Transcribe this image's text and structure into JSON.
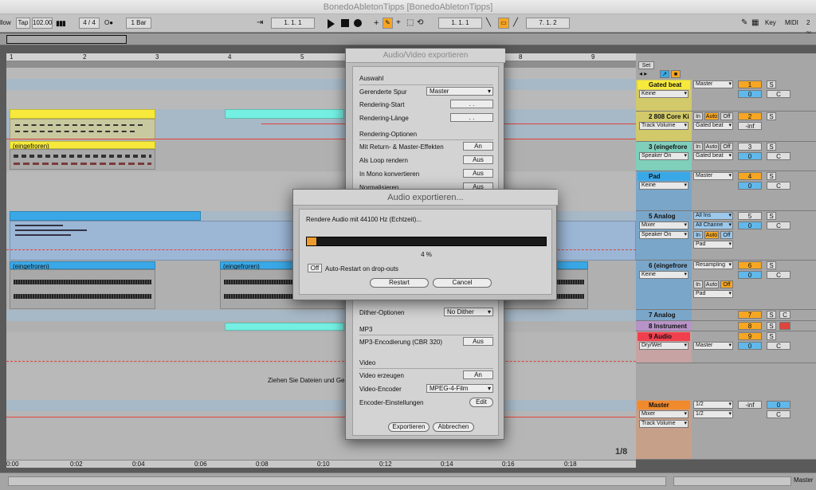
{
  "window_title": "BonedoAbletonTipps  [BonedoAbletonTipps]",
  "transport": {
    "follow": "llow",
    "tap": "Tap",
    "tempo": "102.00",
    "time_sig": "4 / 4",
    "metro": "O●",
    "quantize": "1 Bar",
    "arrangement_pos": "1.  1.  1",
    "loop_start": "1.  1.  1",
    "loop_length": "7.  1.  2",
    "key": "Key",
    "midi": "MIDI",
    "cpu": "2 %"
  },
  "ruler": {
    "bars": [
      "1",
      "2",
      "3",
      "4",
      "5",
      "8",
      "9"
    ],
    "times": [
      "0:00",
      "0:02",
      "0:04",
      "0:06",
      "0:08",
      "0:10",
      "0:12",
      "0:14",
      "0:16",
      "0:18"
    ]
  },
  "arrangement": {
    "frozen_label_1": "(eingefroren)",
    "frozen_label_2": "(eingefroren)",
    "frozen_label_3": "(eingefroren)",
    "drop_hint": "Ziehen Sie Dateien und Gerä",
    "zoom_indicator": "1/8"
  },
  "mixer": {
    "set_label": "Set",
    "tracks": [
      {
        "name": "Gated beat",
        "route_a": "Master",
        "route_b": "Keine",
        "num": "1",
        "num2": "0",
        "s": "S",
        "c": "C",
        "color": "#f6e93c"
      },
      {
        "name": "2 808 Core Ki",
        "route_a": "Gated beat",
        "route_b": "Track Volume",
        "num": "2",
        "num2": "-inf",
        "s": "S",
        "c": "",
        "color": "#f6e93c"
      },
      {
        "name": "3  (eingefrore",
        "route_a": "Gated beat",
        "route_b": "Speaker On",
        "num": "3",
        "num2": "0",
        "s": "S",
        "c": "C",
        "color": "#55e6c1"
      },
      {
        "name": "Pad",
        "route_a": "Master",
        "route_b": "Keine",
        "num": "4",
        "num2": "0",
        "s": "S",
        "c": "C",
        "color": "#3aa8e6"
      },
      {
        "name": "5 Analog",
        "route_a": "All Ins",
        "route_b": "Mixer",
        "route_c": "All Channe",
        "route_d": "Speaker On",
        "route_e": "Pad",
        "num": "5",
        "num2": "0",
        "s": "S",
        "c": "C",
        "color": "#3aa8e6"
      },
      {
        "name": "6  (eingefrore",
        "route_a": "Resampling",
        "route_b": "Keine",
        "route_c": "Pad",
        "num": "6",
        "num2": "0",
        "s": "S",
        "c": "C",
        "color": "#3aa8e6"
      },
      {
        "name": "7 Analog",
        "num": "7",
        "s": "S",
        "c": "C",
        "color": "#3aa8e6"
      },
      {
        "name": "8 Instrument",
        "num": "8",
        "s": "S",
        "c": "",
        "color": "#c17bdc"
      },
      {
        "name": "9 Audio",
        "route_a": "Master",
        "route_b": "Dry/Wet",
        "num": "9",
        "num2": "0",
        "s": "S",
        "c": "C",
        "color": "#f0404e"
      },
      {
        "name": "Master",
        "route_a": "1/2",
        "route_b": "Mixer",
        "route_c": "1/2",
        "route_d": "Track Volume",
        "num": "0",
        "num2": "-inf",
        "c": "C",
        "color": "#f08a2c"
      }
    ],
    "in": "In",
    "auto": "Auto",
    "off": "Off",
    "master_footer": "Master"
  },
  "export_dialog": {
    "title": "Audio/Video exportieren",
    "sections": {
      "selection": "Auswahl",
      "render_options": "Rendering-Optionen",
      "mp3": "MP3",
      "video": "Video"
    },
    "rows": {
      "rendered_track": "Gerenderte Spur",
      "rendered_track_value": "Master",
      "render_start": "Rendering-Start",
      "render_start_value": ".   .",
      "render_length": "Rendering-Länge",
      "render_length_value": ".   .",
      "return_master": "Mit Return- & Master-Effekten",
      "return_master_value": "An",
      "loop": "Als Loop rendern",
      "loop_value": "Aus",
      "mono": "In Mono konvertieren",
      "mono_value": "Aus",
      "normalize": "Normalisieren",
      "normalize_value": "Aus",
      "dither": "Dither-Optionen",
      "dither_value": "No Dither",
      "mp3_cbr": "MP3-Encodierung (CBR 320)",
      "mp3_cbr_value": "Aus",
      "create_video": "Video erzeugen",
      "create_video_value": "An",
      "video_encoder": "Video-Encoder",
      "video_encoder_value": "MPEG-4-Film",
      "encoder_settings": "Encoder-Einstellungen",
      "encoder_settings_value": "Edit"
    },
    "export_button": "Exportieren",
    "cancel_button": "Abbrechen"
  },
  "progress_dialog": {
    "title": "Audio exportieren...",
    "status": "Rendere Audio mit 44100 Hz (Echtzeit)...",
    "percent": "4 %",
    "progress_fraction": 0.04,
    "auto_restart_toggle": "Off",
    "auto_restart_label": "Auto-Restart on drop-outs",
    "restart_button": "Restart",
    "cancel_button": "Cancel"
  },
  "colors": {
    "yellow_clip": "#f6e93c",
    "cyan_clip": "#74efe2",
    "blue_clip": "#3aa8e6",
    "orange_accent": "#f6a623",
    "progress_fill": "#ef9a2c"
  }
}
